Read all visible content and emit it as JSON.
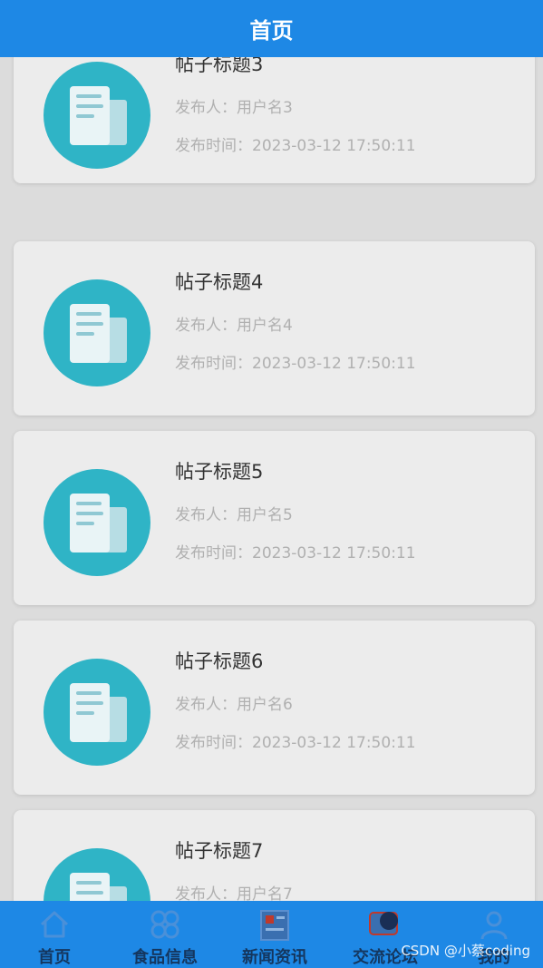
{
  "header": {
    "title": "首页"
  },
  "posts": [
    {
      "title": "帖子标题3",
      "author": "发布人：用户名3",
      "time": "发布时间：2023-03-12 17:50:11"
    },
    {
      "title": "帖子标题4",
      "author": "发布人：用户名4",
      "time": "发布时间：2023-03-12 17:50:11"
    },
    {
      "title": "帖子标题5",
      "author": "发布人：用户名5",
      "time": "发布时间：2023-03-12 17:50:11"
    },
    {
      "title": "帖子标题6",
      "author": "发布人：用户名6",
      "time": "发布时间：2023-03-12 17:50:11"
    },
    {
      "title": "帖子标题7",
      "author": "发布人：用户名7",
      "time": ""
    }
  ],
  "tabbar": {
    "items": [
      {
        "label": "首页",
        "icon": "home-icon"
      },
      {
        "label": "食品信息",
        "icon": "grid-icon"
      },
      {
        "label": "新闻资讯",
        "icon": "news-icon"
      },
      {
        "label": "交流论坛",
        "icon": "chat-icon"
      },
      {
        "label": "我的",
        "icon": "user-icon"
      }
    ]
  },
  "watermark": "CSDN @小蔡coding",
  "colors": {
    "primary": "#1e88e5",
    "avatar": "#2fb4c6",
    "card": "#ececec"
  }
}
